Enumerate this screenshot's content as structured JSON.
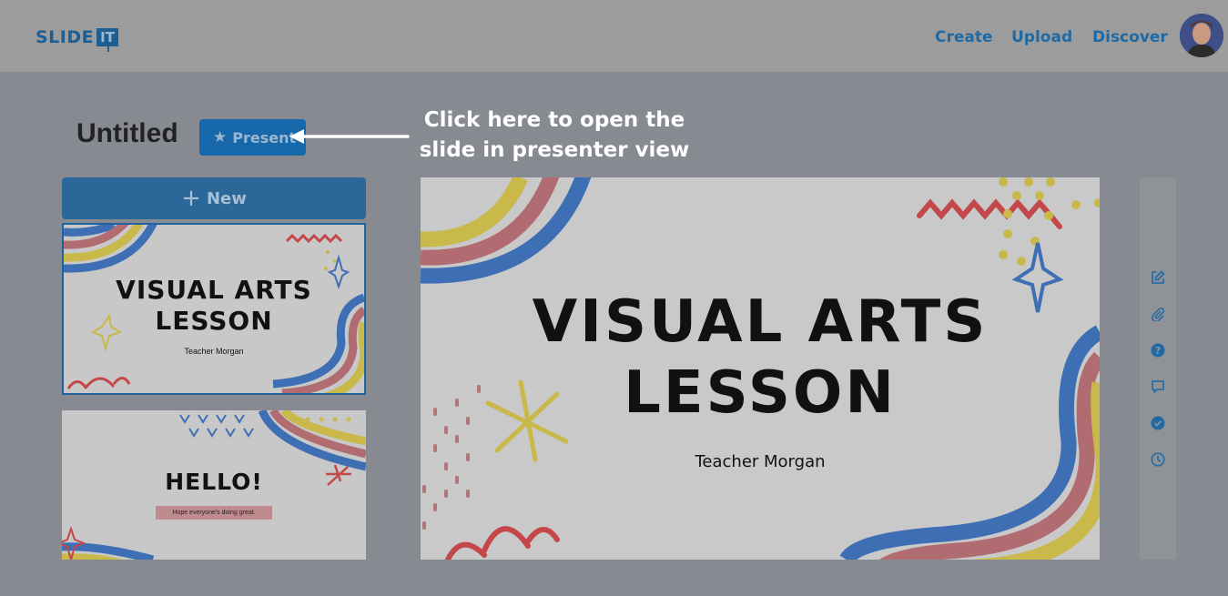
{
  "brand": {
    "logo_word": "SLIDE",
    "logo_badge": "IT"
  },
  "nav": {
    "create": "Create",
    "upload": "Upload",
    "discover": "Discover"
  },
  "user": {
    "avatar_icon": "user-avatar"
  },
  "deck": {
    "title": "Untitled",
    "present_label": "Present"
  },
  "callout": {
    "text": "Click here to open the slide in presenter view"
  },
  "sidebar": {
    "new_label": "New"
  },
  "slides": [
    {
      "title_line1": "VISUAL ARTS",
      "title_line2": "LESSON",
      "subtitle": "Teacher Morgan"
    },
    {
      "title": "HELLO!",
      "subtitle": "Hope everyone's doing great."
    }
  ],
  "main_slide": {
    "title_line1": "VISUAL ARTS",
    "title_line2": "LESSON",
    "subtitle": "Teacher Morgan"
  },
  "toolbar": {
    "icons": [
      "edit-icon",
      "attachment-icon",
      "help-icon",
      "comment-icon",
      "check-icon",
      "history-icon"
    ]
  },
  "colors": {
    "accent": "#1668ab",
    "overlay": "#878b91",
    "rainbow_blue": "#3e6fb5",
    "rainbow_red": "#b06c70",
    "rainbow_yellow": "#c9b84a",
    "squiggle_red": "#c4474a"
  }
}
